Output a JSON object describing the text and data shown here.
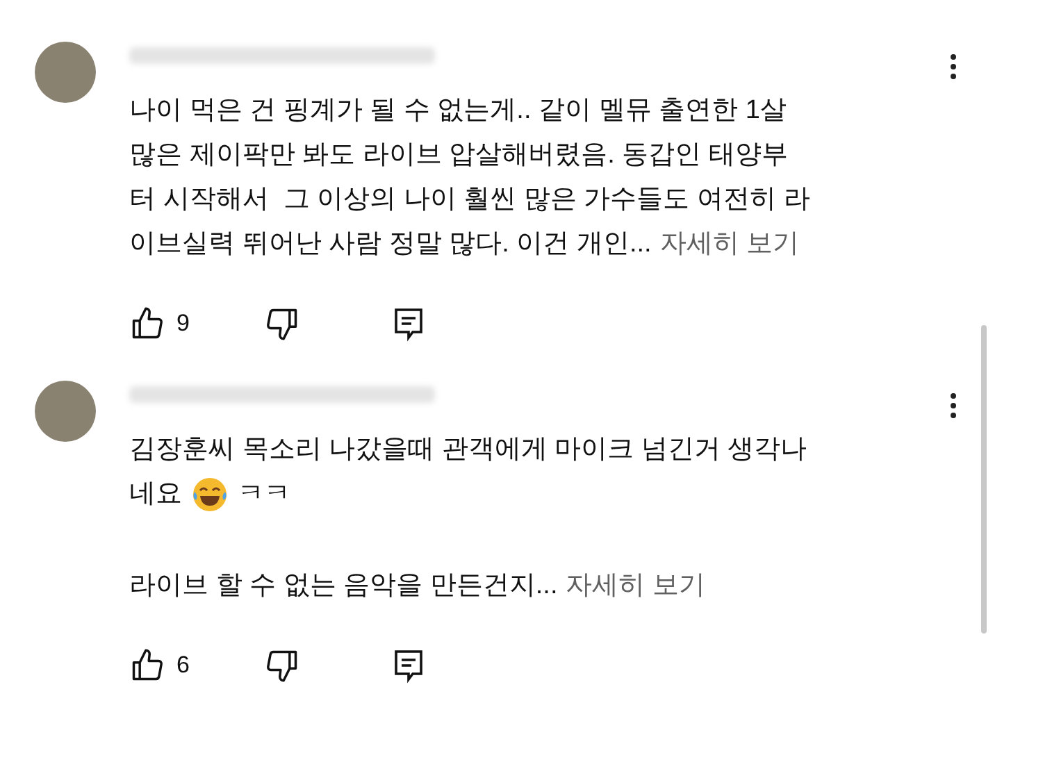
{
  "comments": [
    {
      "paragraphs": [
        [
          [
            {
              "kind": "text",
              "text": "나이 먹은 건 핑계가 될 수 없는게.. 같이 멜뮤 출연한 1살"
            }
          ],
          [
            {
              "kind": "text",
              "text": "많은 제이팍만 봐도 라이브 압살해버렸음. 동갑인 태양부"
            }
          ],
          [
            {
              "kind": "text",
              "text": "터 시작해서  그 이상의 나이 훨씬 많은 가수들도 여전히 라"
            }
          ],
          [
            {
              "kind": "text",
              "text": "이브실력 뛰어난 사람 정말 많다. 이건 개인..."
            },
            {
              "kind": "more",
              "text": "자세히 보기"
            }
          ]
        ]
      ],
      "likes": "9"
    },
    {
      "paragraphs": [
        [
          [
            {
              "kind": "text",
              "text": "김장훈씨 목소리 나갔을때 관객에게 마이크 넘긴거 생각나"
            }
          ],
          [
            {
              "kind": "text",
              "text": "네요"
            },
            {
              "kind": "emoji"
            },
            {
              "kind": "text",
              "text": "ㅋㅋ"
            }
          ]
        ],
        [
          [
            {
              "kind": "text",
              "text": "라이브 할 수 없는 음악을 만든건지..."
            },
            {
              "kind": "more",
              "text": "자세히 보기"
            }
          ]
        ]
      ],
      "likes": "6"
    }
  ]
}
